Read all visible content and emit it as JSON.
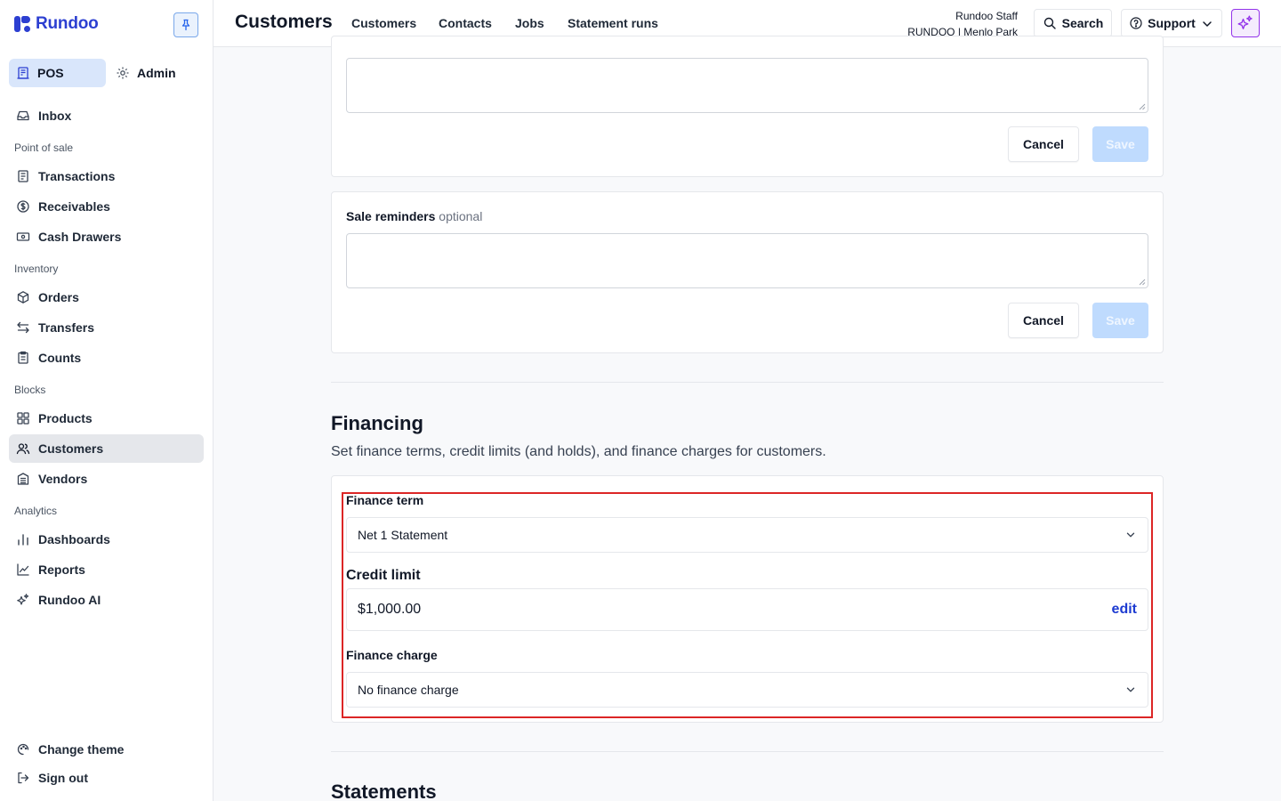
{
  "brand": {
    "name": "Rundoo",
    "color": "#2c3fd1"
  },
  "modes": {
    "pos": "POS",
    "admin": "Admin"
  },
  "sidebar": {
    "inbox": "Inbox",
    "sections": [
      {
        "title": "Point of sale",
        "items": [
          "Transactions",
          "Receivables",
          "Cash Drawers"
        ]
      },
      {
        "title": "Inventory",
        "items": [
          "Orders",
          "Transfers",
          "Counts"
        ]
      },
      {
        "title": "Blocks",
        "items": [
          "Products",
          "Customers",
          "Vendors"
        ]
      },
      {
        "title": "Analytics",
        "items": [
          "Dashboards",
          "Reports",
          "Rundoo AI"
        ]
      }
    ],
    "active_item": "Customers",
    "footer": {
      "change_theme": "Change theme",
      "sign_out": "Sign out"
    }
  },
  "header": {
    "title": "Customers",
    "tabs": [
      "Customers",
      "Contacts",
      "Jobs",
      "Statement runs"
    ],
    "user_name": "Rundoo Staff",
    "user_org": "RUNDOO | Menlo Park",
    "search_label": "Search",
    "support_label": "Support"
  },
  "notes_card": {
    "cancel_label": "Cancel",
    "save_label": "Save"
  },
  "sale_reminders": {
    "label": "Sale reminders",
    "optional": "optional",
    "cancel_label": "Cancel",
    "save_label": "Save"
  },
  "financing": {
    "title": "Financing",
    "description": "Set finance terms, credit limits (and holds), and finance charges for customers.",
    "finance_term_label": "Finance term",
    "finance_term_value": "Net 1 Statement",
    "credit_limit_label": "Credit limit",
    "credit_limit_value": "$1,000.00",
    "edit_label": "edit",
    "finance_charge_label": "Finance charge",
    "finance_charge_value": "No finance charge"
  },
  "statements": {
    "title": "Statements"
  },
  "colors": {
    "highlight": "#dc2626",
    "accent": "#2c3fd1",
    "save_disabled": "#bfdbfe",
    "ai": "#9333ea"
  }
}
